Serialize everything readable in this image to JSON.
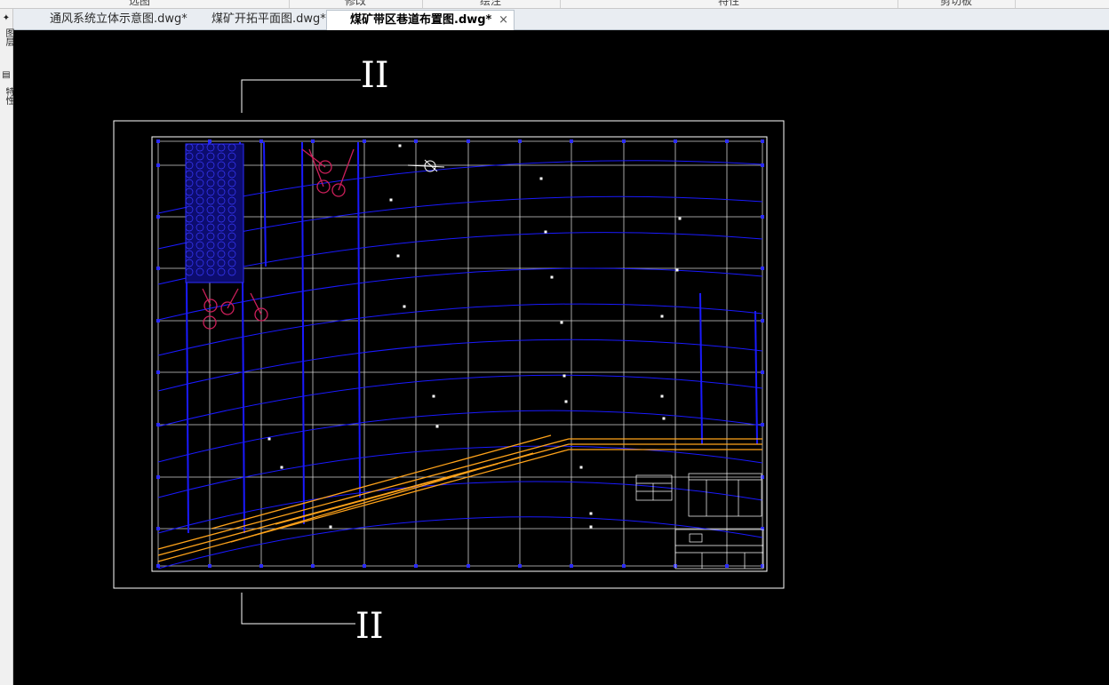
{
  "ribbon": {
    "groups": [
      "选图",
      "修改",
      "绘注",
      "特性",
      "剪切板"
    ]
  },
  "tabs": [
    {
      "label": "通风系统立体示意图.dwg*",
      "active": false
    },
    {
      "label": "煤矿开拓平面图.dwg*",
      "active": false
    },
    {
      "label": "煤矿带区巷道布置图.dwg*",
      "active": true
    }
  ],
  "tab_close_symbol": "×",
  "left_palette": {
    "items": [
      "✦",
      "图层",
      "▤",
      "特性"
    ]
  },
  "drawing": {
    "section_mark_top": "II",
    "section_mark_bottom": "II"
  },
  "colors": {
    "canvas_bg": "#000000",
    "frame": "#ffffff",
    "contour": "#1a1aff",
    "roadway": "#ffa31a",
    "equipment": "#cc1f5a"
  }
}
